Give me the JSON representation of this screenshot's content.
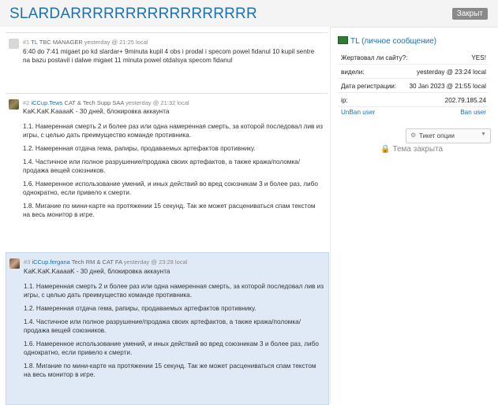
{
  "header": {
    "title": "SLARDARRRRRRRRRRRRRRRRR",
    "status_badge": "Закрыт"
  },
  "posts": [
    {
      "number": "#1",
      "user": "TL",
      "role": "TBC MANAGER",
      "time": "yesterday @ 21:25 local",
      "lead": "6:40 do 7:41 migaet po kd slardar+ 9minuta kupil 4 obs i prodal i specom powel fidanul 10 kupil sentre na bazu postavil i dalwe migaet 11 minuta powel otdalsya specom fidanul",
      "paragraphs": []
    },
    {
      "number": "#2",
      "user": "iCCup.Tews",
      "role": "CAT & Tech Supp SAA",
      "time": "yesterday @ 21:32 local",
      "lead": "KaK.KaK.KaaaaK - 30 дней, блокировка аккаунта",
      "paragraphs": [
        "1.1. Намеренная смерть 2 и более раз или одна намеренная смерть, за которой последовал лив из игры, с целью дать преимущество команде противника.",
        "1.2. Намеренная отдача гема, рапиры, продаваемых артефактов противнику.",
        "1.4. Частичное или полное разрушение/продажа своих артефактов, а также кража/поломка/продажа вещей союзников.",
        "1.6. Намеренное использование умений, и иных действий во вред союзникам 3 и более раз, либо однократно, если привело к смерти.",
        "1.8. Мигание по мини-карте на протяжении 15 секунд. Так же может расцениваться спам текстом на весь монитор в игре."
      ]
    },
    {
      "number": "#3",
      "user": "iCCup.fergana",
      "role": "Tech RM & CAT FA",
      "time": "yesterday @ 23:28 local",
      "lead": "KaK.KaK.KaaaaK - 30 дней, блокировка аккаунта",
      "paragraphs": [
        "1.1. Намеренная смерть 2 и более раз или одна намеренная смерть, за которой последовал лив из игры, с целью дать преимущество команде противника.",
        "1.2. Намеренная отдача гема, рапиры, продаваемых артефактов противнику.",
        "1.4. Частичное или полное разрушение/продажа своих артефактов, а также кража/поломка/продажа вещей союзников.",
        "1.6. Намеренное использование умений, и иных действий во вред союзникам 3 и более раз, либо однократно, если привело к смерти.",
        "1.8. Мигание по мини-карте на протяжении 15 секунд. Так же может расцениваться спам текстом на весь монитор в игре."
      ]
    }
  ],
  "sidebar": {
    "title": "TL (личное сообщение)",
    "rows": [
      {
        "label": "Жертвовал ли сайту?:",
        "value": "YES!"
      },
      {
        "label": "видели:",
        "value": "yesterday @ 23:24 local"
      },
      {
        "label": "Дата регистрации:",
        "value": "30 Jan 2023 @ 21:55 local"
      },
      {
        "label": "ip:",
        "value": "202.79.185.24"
      }
    ],
    "unban_label": "UnBan user",
    "ban_label": "Ban user",
    "ticket_options_label": "Тикет опции",
    "locked_label": "Тема закрыта"
  },
  "colors": {
    "accent": "#1f6fb5",
    "highlight_bg": "#dfeaf6",
    "badge_bg": "#8a8a8a"
  }
}
